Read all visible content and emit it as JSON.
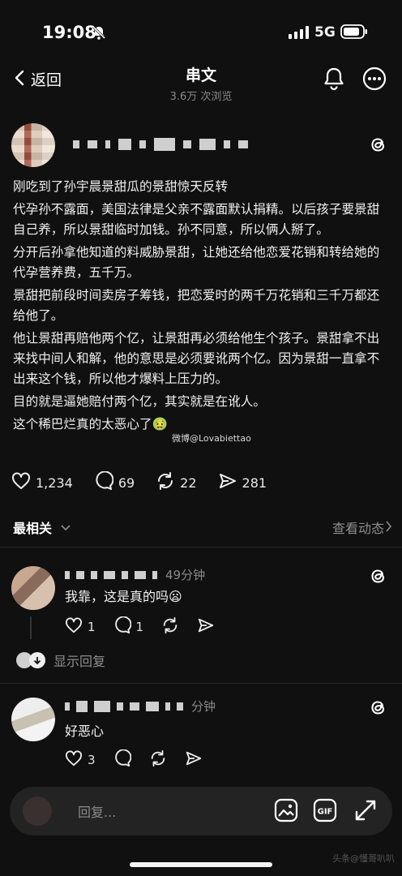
{
  "status_bar": {
    "time": "19:08",
    "network": "5G"
  },
  "topbar": {
    "back_label": "返回",
    "title": "串文",
    "subtitle": "3.6万 次浏览"
  },
  "post": {
    "paragraphs": [
      "刚吃到了孙宇晨景甜瓜的景甜惊天反转",
      "代孕孙不露面，美国法律是父亲不露面默认捐精。以后孩子要景甜自己养，所以景甜临时加钱。孙不同意，所以俩人掰了。",
      "分开后孙拿他知道的料威胁景甜，让她还给他恋爱花销和转给她的代孕营养费，五千万。",
      "景甜把前段时间卖房子筹钱，把恋爱时的两千万花销和三千万都还给他了。",
      "他让景甜再赔他两个亿，让景甜再必须给他生个孩子。景甜拿不出来找中间人和解，他的意思是必须要讹两个亿。因为景甜一直拿不出来这个钱，所以他才爆料上压力的。",
      "目的就是逼她赔付两个亿，其实就是在讹人。",
      "这个稀巴烂真的太恶心了🤢"
    ],
    "watermark": "微博@Lovabiettao",
    "likes": "1,234",
    "comments": "69",
    "reposts": "22",
    "shares": "281"
  },
  "sort": {
    "label": "最相关",
    "activity_label": "查看动态"
  },
  "comments": [
    {
      "time": "49分钟",
      "text": "我靠，这是真的吗😦",
      "likes": "1",
      "replies": "1"
    },
    {
      "time": "分钟",
      "text": "好恶心",
      "likes": "3"
    }
  ],
  "show_replies_label": "显示回复",
  "compose": {
    "placeholder": "回复..."
  },
  "corner_watermark": "头条@懂哥叭叭"
}
